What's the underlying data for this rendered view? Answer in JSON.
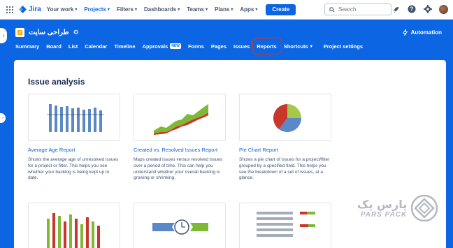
{
  "topnav": {
    "logo_text": "Jira",
    "items": [
      {
        "label": "Your work",
        "active": false
      },
      {
        "label": "Projects",
        "active": true
      },
      {
        "label": "Filters",
        "active": false
      },
      {
        "label": "Dashboards",
        "active": false
      },
      {
        "label": "Teams",
        "active": false
      },
      {
        "label": "Plans",
        "active": false
      },
      {
        "label": "Apps",
        "active": false
      }
    ],
    "create_label": "Create",
    "search_placeholder": "Search"
  },
  "project": {
    "name": "طراحی سایت",
    "automation_label": "Automation",
    "tabs": [
      {
        "label": "Summary"
      },
      {
        "label": "Board"
      },
      {
        "label": "List"
      },
      {
        "label": "Calendar"
      },
      {
        "label": "Timeline"
      },
      {
        "label": "Approvals",
        "badge": "NEW"
      },
      {
        "label": "Forms"
      },
      {
        "label": "Pages"
      },
      {
        "label": "Issues"
      },
      {
        "label": "Reports",
        "highlighted": true
      },
      {
        "label": "Shortcuts",
        "dropdown": true
      },
      {
        "label": "Project settings"
      }
    ]
  },
  "content": {
    "section_title": "Issue analysis",
    "reports": [
      {
        "title": "Average Age Report",
        "description": "Shows the average age of unresolved issues for a project or filter. This helps you see whether your backlog is being kept up to date."
      },
      {
        "title": "Created vs. Resolved Issues Report",
        "description": "Maps created issues versus resolved issues over a period of time. This can help you understand whether your overall backlog is growing or shrinking."
      },
      {
        "title": "Pie Chart Report",
        "description": "Shows a pie chart of issues for a project/filter grouped by a specified field. This helps you see the breakdown of a set of issues, at a glance."
      }
    ]
  },
  "watermark": {
    "persian": "پارس پک",
    "english": "PARS PACK"
  },
  "colors": {
    "brand": "#0c66e4",
    "bar_blue": "#5b88c8",
    "green": "#7eb936",
    "red": "#c9372c",
    "yellow_green": "#a6c84b",
    "gray": "#a5adba"
  }
}
